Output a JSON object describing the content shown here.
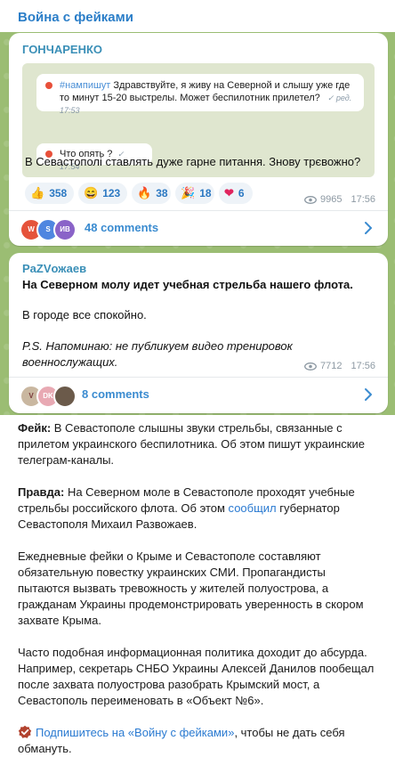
{
  "channel": {
    "title": "Война с фейками"
  },
  "post1": {
    "author": "ГОНЧАРЕНКО",
    "screenshot": {
      "bubble1": {
        "tag": "#нампишут",
        "text": "Здравствуйте, я живу на Северной и слышу уже где то минут 15-20 выстрелы. Может беспилотник прилетел?",
        "meta": "ред. 17:53"
      },
      "bubble2": {
        "text": "Что опять ?",
        "meta": "17:54"
      }
    },
    "text": "В Севастополі ставлять дуже гарне питання. Знову трєвожно?",
    "reactions": [
      {
        "emoji": "👍",
        "count": "358"
      },
      {
        "emoji": "😄",
        "count": "123"
      },
      {
        "emoji": "🔥",
        "count": "38"
      },
      {
        "emoji": "🎉",
        "count": "18"
      },
      {
        "emoji": "❤",
        "count": "6"
      }
    ],
    "views": "9965",
    "time": "17:56",
    "avatars": [
      {
        "initials": "W",
        "color": "#e5533b"
      },
      {
        "initials": "S",
        "color": "#4f86e0"
      },
      {
        "initials": "ИВ",
        "color": "#8a63c8"
      }
    ],
    "comments": "48 comments"
  },
  "post2": {
    "author": "PaZVожаев",
    "headline": "На Северном молу идет учебная стрельба нашего флота.",
    "line2": "В городе все спокойно.",
    "ps_line1": "P.S. Напоминаю: не публикуем видео тренировок",
    "ps_line2": "военнослужащих.",
    "views": "7712",
    "time": "17:56",
    "avatars": [
      {
        "initials": "V",
        "color": "#c9b7a0"
      },
      {
        "initials": "DK",
        "color": "#e8a9b3"
      },
      {
        "initials": "",
        "color": "#6b5a4a"
      }
    ],
    "comments": "8 comments"
  },
  "article": {
    "fake_label": "Фейк:",
    "fake_text": " В Севастополе слышны звуки стрельбы, связанные с прилетом украинского беспилотника. Об этом пишут украинские телеграм-каналы.",
    "truth_label": "Правда:",
    "truth_text_1": " На Северном моле в Севастополе проходят учебные стрельбы российского флота. Об этом ",
    "truth_link": "сообщил",
    "truth_text_2": " губернатор Севастополя Михаил Развожаев.",
    "para3": "Ежедневные фейки о Крыме и Севастополе составляют обязательную повестку украинских СМИ. Пропагандисты пытаются вызвать тревожность у жителей полуострова, а гражданам Украины продемонстрировать уверенность в скором захвате Крыма.",
    "para4": "Часто подобная информационная политика доходит до абсурда. Например, секретарь СНБО Украины Алексей Данилов пообещал после захвата полуострова разобрать Крымский мост, а Севастополь переименовать в «Объект №6».",
    "subscribe_link": "Подпишитесь на «Войну с фейками»",
    "subscribe_rest": ", чтобы не дать себя обмануть."
  },
  "colors": {
    "accent": "#2b7ec8",
    "reaction_bg": "#eef3f8",
    "chat_bg": "#9bbd73"
  }
}
